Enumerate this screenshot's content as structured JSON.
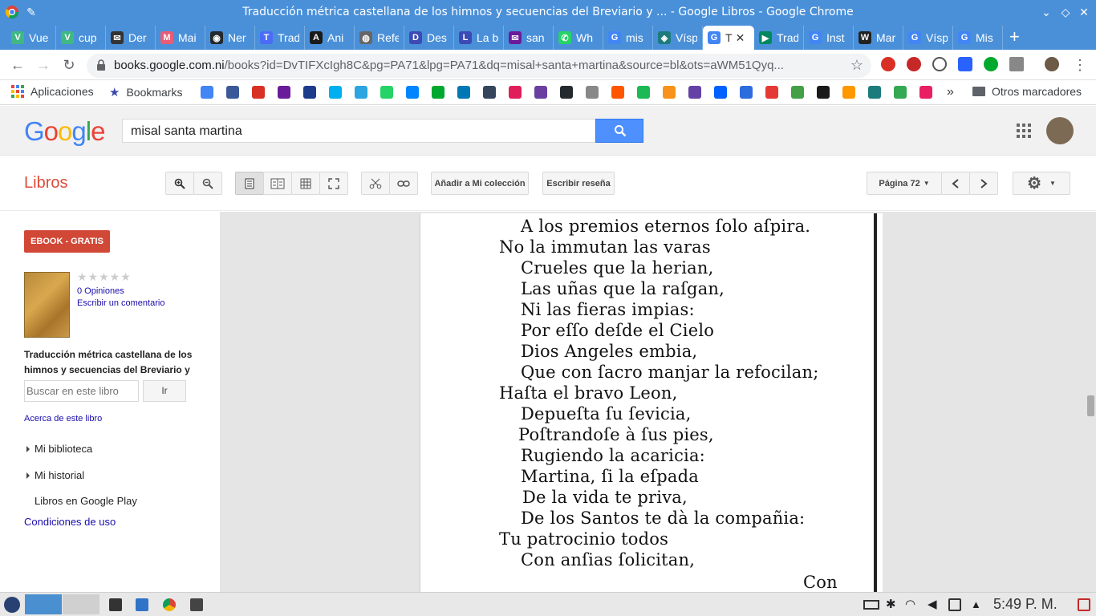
{
  "window": {
    "title": "Traducción métrica castellana de los himnos y secuencias del Breviario y ... - Google Libros - Google Chrome"
  },
  "tabs": [
    {
      "label": "Vue",
      "color": "#41b883",
      "glyph": "V"
    },
    {
      "label": "cup",
      "color": "#41b883",
      "glyph": "V"
    },
    {
      "label": "Der",
      "color": "#333333",
      "glyph": "✉"
    },
    {
      "label": "Mai",
      "color": "#e85d75",
      "glyph": "M"
    },
    {
      "label": "Ner",
      "color": "#24292e",
      "glyph": "◉"
    },
    {
      "label": "Trad",
      "color": "#4a6cf7",
      "glyph": "T"
    },
    {
      "label": "Ani",
      "color": "#1a1a1a",
      "glyph": "A"
    },
    {
      "label": "Refe",
      "color": "#666666",
      "glyph": "◍"
    },
    {
      "label": "Des",
      "color": "#3b4ab4",
      "glyph": "D"
    },
    {
      "label": "La b",
      "color": "#3b4ab4",
      "glyph": "L"
    },
    {
      "label": "san",
      "color": "#6a1b9a",
      "glyph": "✉"
    },
    {
      "label": "Wh",
      "color": "#25d366",
      "glyph": "✆"
    },
    {
      "label": "mis",
      "color": "#4285f4",
      "glyph": "G"
    },
    {
      "label": "Vísp",
      "color": "#1e7b7b",
      "glyph": "◈"
    },
    {
      "label": "T",
      "color": "#4285f4",
      "glyph": "G",
      "active": true
    },
    {
      "label": "Trad",
      "color": "#01875f",
      "glyph": "▶"
    },
    {
      "label": "Inst",
      "color": "#4285f4",
      "glyph": "G"
    },
    {
      "label": "Mar",
      "color": "#222222",
      "glyph": "W"
    },
    {
      "label": "Vísp",
      "color": "#4285f4",
      "glyph": "G"
    },
    {
      "label": "Mis",
      "color": "#4285f4",
      "glyph": "G"
    }
  ],
  "address": {
    "host": "books.google.com.ni",
    "path": "/books?id=DvTIFXcIgh8C&pg=PA71&lpg=PA71&dq=misal+santa+martina&source=bl&ots=aWM51Qyq..."
  },
  "bookmarks": {
    "apps_label": "Aplicaciones",
    "bookmarks_label": "Bookmarks",
    "more": "»",
    "other_label": "Otros marcadores"
  },
  "google": {
    "logo": "Google",
    "search_value": "misal santa martina"
  },
  "toolbar": {
    "section": "Libros",
    "add_collection": "Añadir a Mi colección",
    "write_review": "Escribir reseña",
    "page_label": "Página 72"
  },
  "sidebar": {
    "ebook": "EBOOK - GRATIS",
    "stars": "★★★★★",
    "opinions": "0 Opiniones",
    "write_comment": "Escribir un comentario",
    "book_title": "Traducción métrica castellana de los himnos y secuencias del Breviario y ...",
    "search_placeholder": "Buscar en este libro",
    "go": "Ir",
    "about": "Acerca de este libro",
    "my_library": "Mi biblioteca",
    "my_history": "Mi historial",
    "play_books": "Libros en Google Play",
    "terms": "Condiciones de uso"
  },
  "page_text": [
    "A los premios eternos ſolo aſpira.",
    "No la immutan las varas",
    "Crueles que la herian,",
    "Las uñas que la raſgan,",
    "Ni las fieras impias:",
    "Por eſſo deſde el Cielo",
    "Dios Angeles embia,",
    "Que con ſacro manjar la refocilan;",
    "Haſta el bravo Leon,",
    "Depueſta ſu ſevicia,",
    "Poſtrandoſe à ſus pies,",
    "Rugiendo la acaricia:",
    "Martina, ſi la eſpada",
    "De la vida te priva,",
    "De los Santos te dà la compañia:",
    "Tu patrocinio todos",
    "Con anſias ſolicitan,",
    "Con"
  ],
  "taskbar": {
    "time": "5:49 P. M."
  }
}
